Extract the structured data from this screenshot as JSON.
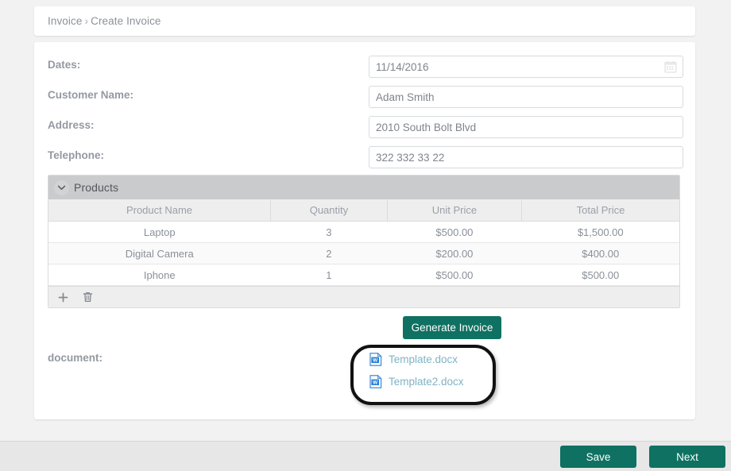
{
  "breadcrumb": {
    "root": "Invoice",
    "separator": "›",
    "current": "Create Invoice"
  },
  "form": {
    "fields": [
      {
        "label": "Dates:",
        "value": "11/14/2016",
        "placeholder": "",
        "icon": "calendar-icon",
        "name": "dates"
      },
      {
        "label": "Customer Name:",
        "value": "Adam Smith",
        "placeholder": "",
        "icon": "",
        "name": "customer-name"
      },
      {
        "label": "Address:",
        "value": "2010 South Bolt Blvd",
        "placeholder": "",
        "icon": "",
        "name": "address"
      },
      {
        "label": "Telephone:",
        "value": "322 332 33 22",
        "placeholder": "",
        "icon": "",
        "name": "telephone"
      }
    ]
  },
  "products_panel": {
    "title": "Products",
    "collapse_icon": "chevron-down-icon",
    "columns": [
      "Product Name",
      "Quantity",
      "Unit Price",
      "Total Price"
    ],
    "rows": [
      {
        "product_name": "Laptop",
        "quantity": "3",
        "unit_price": "$500.00",
        "total_price": "$1,500.00"
      },
      {
        "product_name": "Digital Camera",
        "quantity": "2",
        "unit_price": "$200.00",
        "total_price": "$400.00"
      },
      {
        "product_name": "Iphone",
        "quantity": "1",
        "unit_price": "$500.00",
        "total_price": "$500.00"
      }
    ],
    "toolbar": [
      {
        "icon": "plus-icon",
        "name": "add-row-button"
      },
      {
        "icon": "trash-icon",
        "name": "delete-row-button"
      }
    ]
  },
  "actions": {
    "generate_invoice": "Generate Invoice"
  },
  "document_section": {
    "label": "document:",
    "files": [
      {
        "name": "Template.docx",
        "icon": "word-document-icon"
      },
      {
        "name": "Template2.docx",
        "icon": "word-document-icon"
      }
    ]
  },
  "footer": {
    "save_label": "Save",
    "next_label": "Next"
  },
  "colors": {
    "accent": "#0f7162",
    "page_background": "#f2f2f2",
    "panel_header": "#c9cbcd",
    "link": "#7fb3c4",
    "annotation": "#111111"
  }
}
